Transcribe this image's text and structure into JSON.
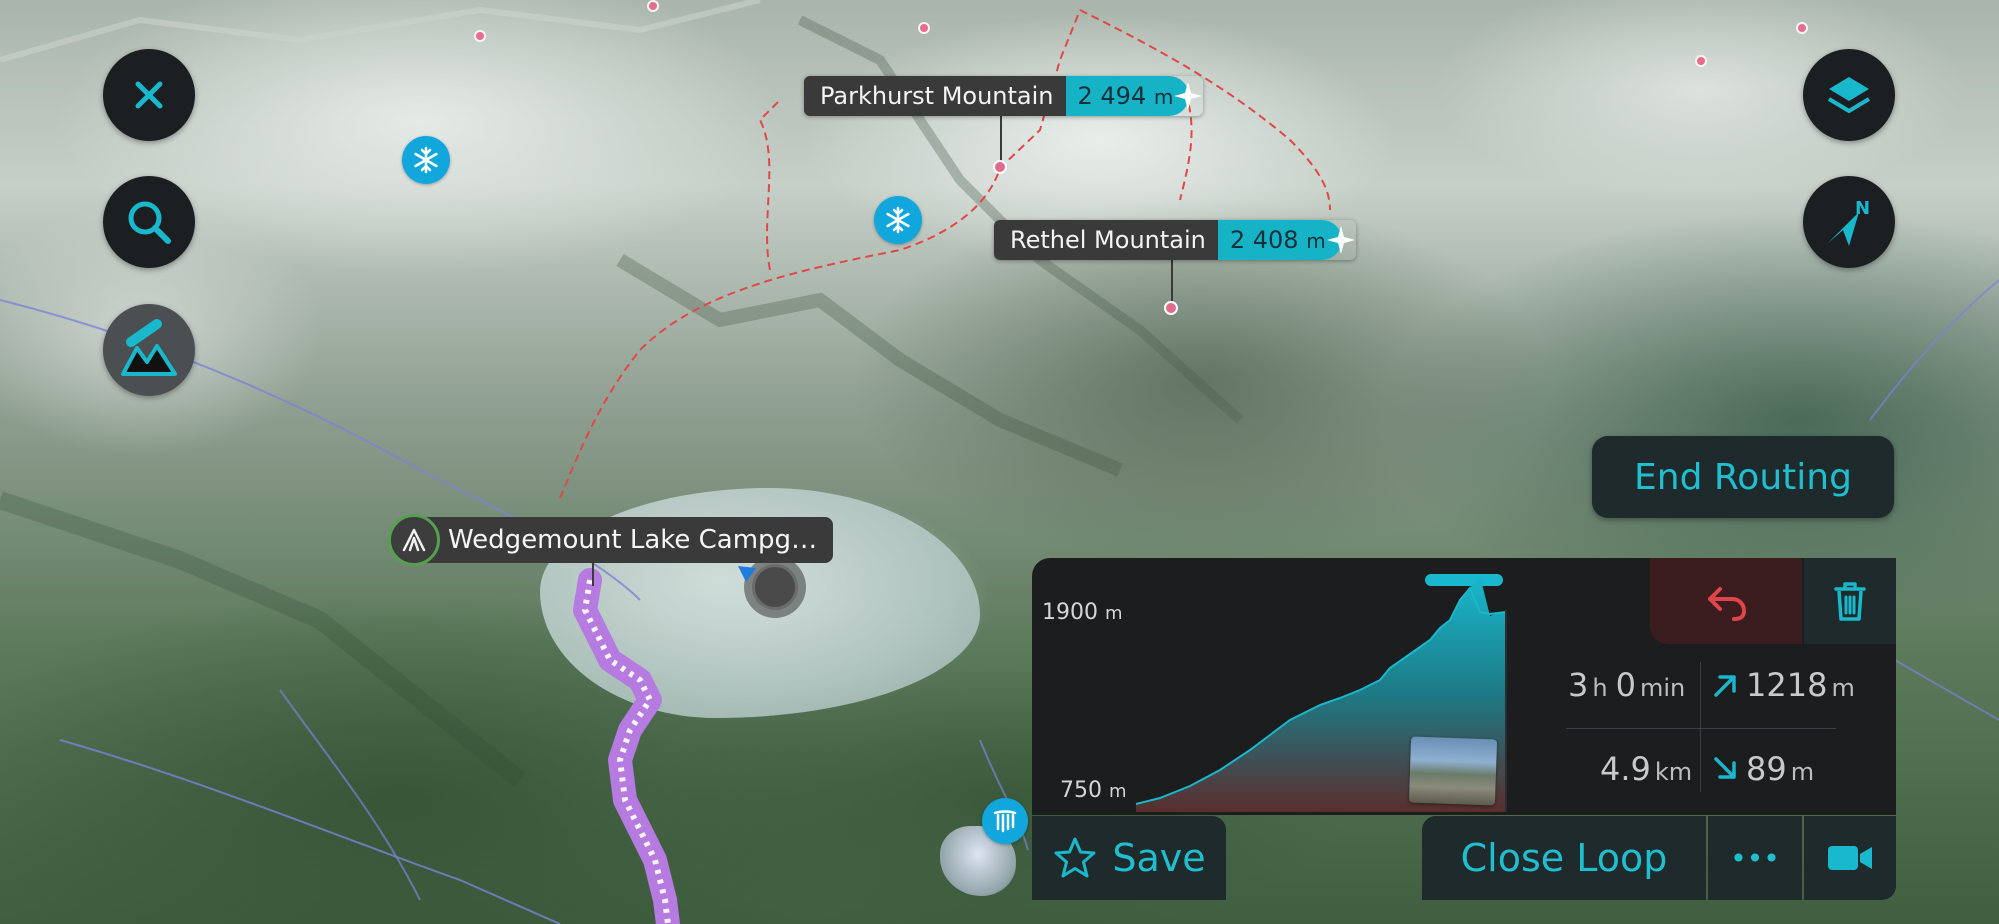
{
  "map": {
    "peaks": [
      {
        "name": "Parkhurst Mountain",
        "elevation_value": "2 494",
        "elevation_unit": "m"
      },
      {
        "name": "Rethel Mountain",
        "elevation_value": "2 408",
        "elevation_unit": "m"
      }
    ],
    "campground": {
      "name": "Wedgemount Lake Campg…"
    }
  },
  "controls": {
    "close_icon": "close-icon",
    "search_icon": "search-icon",
    "terrain_icon": "mountain-pencil-icon",
    "layers_icon": "layers-icon",
    "compass_icon": "compass-north-icon",
    "compass_letter": "N"
  },
  "routing": {
    "end_label": "End Routing",
    "profile": {
      "max_value": "1900",
      "max_unit": "m",
      "min_value": "750",
      "min_unit": "m"
    },
    "stats": {
      "hours": "3",
      "hours_unit": "h",
      "minutes": "0",
      "minutes_unit": "min",
      "ascent": "1218",
      "ascent_unit": "m",
      "distance": "4.9",
      "distance_unit": "km",
      "descent": "89",
      "descent_unit": "m"
    },
    "save_label": "Save",
    "close_loop_label": "Close Loop",
    "more_label": "•••"
  },
  "colors": {
    "accent": "#19b8cc",
    "route": "#b57be0",
    "undo": "#e0454b",
    "peak_dot": "#e06b8b"
  }
}
